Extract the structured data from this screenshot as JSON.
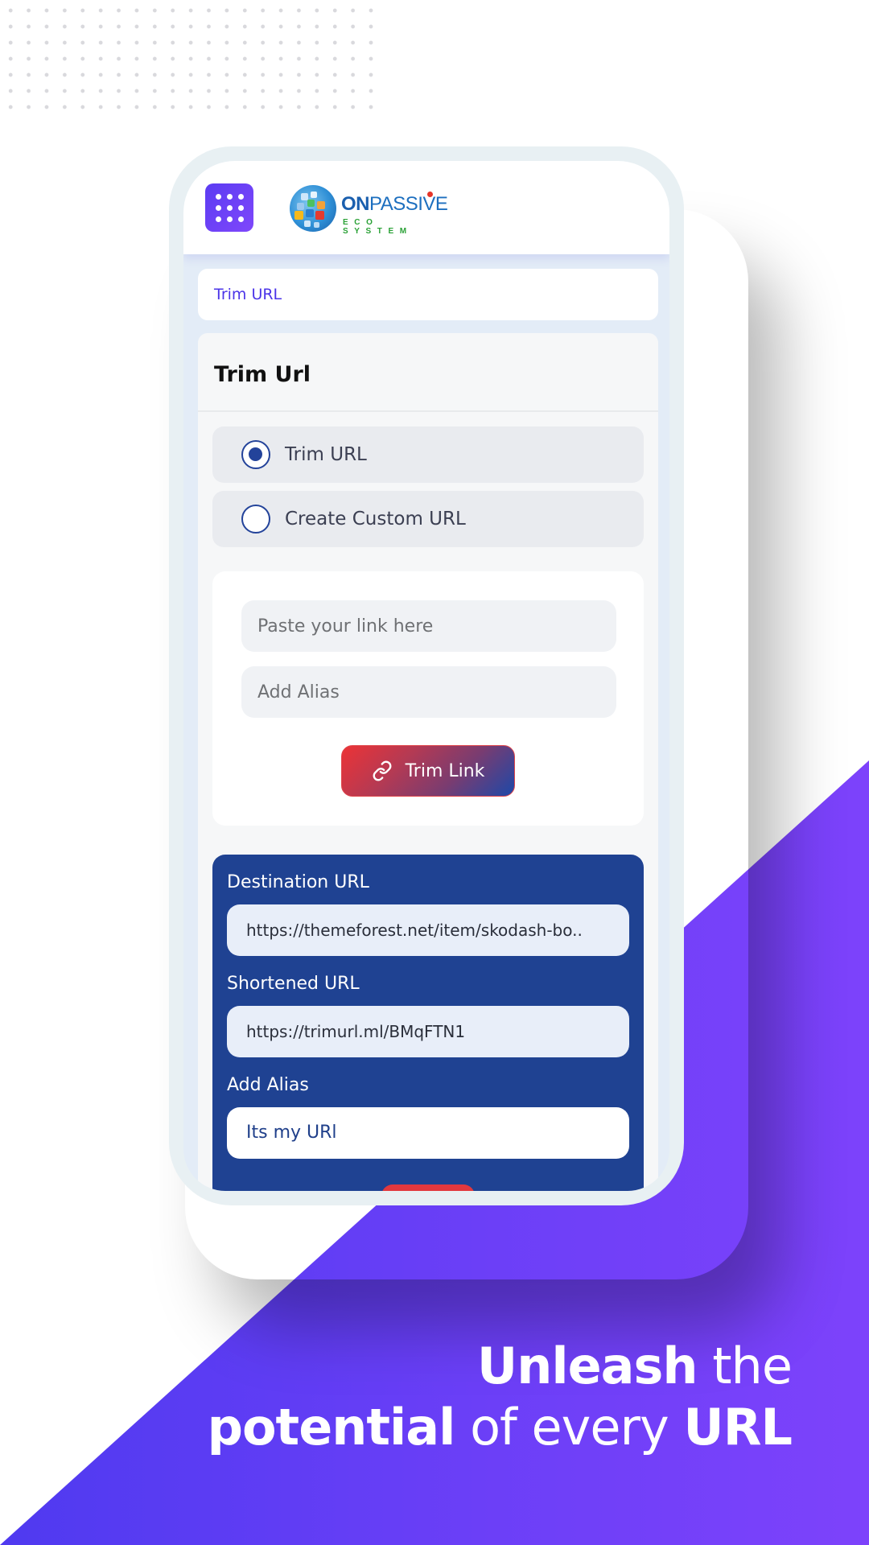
{
  "header": {
    "menu_icon": "grid-dots-icon",
    "logo": {
      "name": "ONPASSIVE",
      "name_bold_part": "ON",
      "name_rest": "PASSIVE",
      "tagline": "ECO SYSTEM"
    }
  },
  "breadcrumb": {
    "label": "Trim URL"
  },
  "card": {
    "title": "Trim Url",
    "options": [
      {
        "label": "Trim URL",
        "selected": true
      },
      {
        "label": "Create Custom URL",
        "selected": false
      }
    ],
    "form": {
      "link_placeholder": "Paste your link here",
      "alias_placeholder": "Add Alias",
      "submit_label": "Trim Link",
      "submit_icon": "link-icon"
    },
    "result": {
      "destination_label": "Destination URL",
      "destination_value": "https://themeforest.net/item/skodash-bo..",
      "shortened_label": "Shortened URL",
      "shortened_value": "https://trimurl.ml/BMqFTN1",
      "alias_label": "Add Alias",
      "alias_value": "Its my URl"
    }
  },
  "tagline": {
    "line1_bold": "Unleash",
    "line1_light": " the",
    "line2_bold": "potential",
    "line2_light": " of every ",
    "line2_bold_end": "URL"
  },
  "colors": {
    "accent_purple": "#5b3cf2",
    "result_blue": "#1f4292",
    "button_red": "#ec3336",
    "radio_blue": "#23439a"
  }
}
